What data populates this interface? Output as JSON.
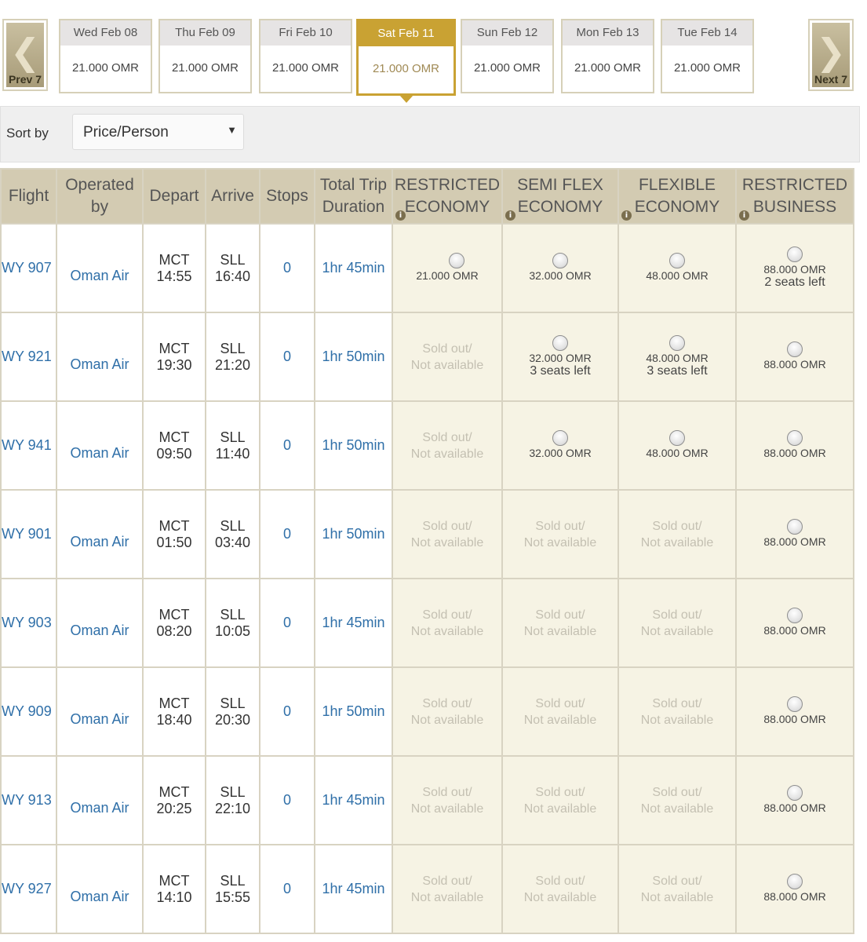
{
  "date_nav": {
    "prev_label": "Prev 7",
    "next_label": "Next 7",
    "days": [
      {
        "date": "Wed Feb 08",
        "price": "21.000 OMR",
        "active": false
      },
      {
        "date": "Thu Feb 09",
        "price": "21.000 OMR",
        "active": false
      },
      {
        "date": "Fri Feb 10",
        "price": "21.000 OMR",
        "active": false
      },
      {
        "date": "Sat Feb 11",
        "price": "21.000 OMR",
        "active": true
      },
      {
        "date": "Sun Feb 12",
        "price": "21.000 OMR",
        "active": false
      },
      {
        "date": "Mon Feb 13",
        "price": "21.000 OMR",
        "active": false
      },
      {
        "date": "Tue Feb 14",
        "price": "21.000 OMR",
        "active": false
      }
    ]
  },
  "sort": {
    "label": "Sort by",
    "selected": "Price/Person"
  },
  "table": {
    "headers": {
      "flight": "Flight",
      "operated_by": [
        "Operated",
        "by"
      ],
      "depart": "Depart",
      "arrive": "Arrive",
      "stops": "Stops",
      "duration": [
        "Total Trip",
        "Duration"
      ],
      "fares": [
        [
          "RESTRICTED",
          "ECONOMY"
        ],
        [
          "SEMI FLEX",
          "ECONOMY"
        ],
        [
          "FLEXIBLE",
          "ECONOMY"
        ],
        [
          "RESTRICTED",
          "BUSINESS"
        ]
      ]
    },
    "sold_out_text": [
      "Sold out/",
      "Not available"
    ],
    "rows": [
      {
        "flight": "WY 907",
        "operator": "Oman Air",
        "dep_code": "MCT",
        "dep_time": "14:55",
        "arr_code": "SLL",
        "arr_time": "16:40",
        "stops": "0",
        "duration": "1hr 45min",
        "fares": [
          {
            "price": "21.000 OMR",
            "seats": ""
          },
          {
            "price": "32.000 OMR",
            "seats": ""
          },
          {
            "price": "48.000 OMR",
            "seats": ""
          },
          {
            "price": "88.000 OMR",
            "seats": "2 seats left"
          }
        ]
      },
      {
        "flight": "WY 921",
        "operator": "Oman Air",
        "dep_code": "MCT",
        "dep_time": "19:30",
        "arr_code": "SLL",
        "arr_time": "21:20",
        "stops": "0",
        "duration": "1hr 50min",
        "fares": [
          null,
          {
            "price": "32.000 OMR",
            "seats": "3 seats left"
          },
          {
            "price": "48.000 OMR",
            "seats": "3 seats left"
          },
          {
            "price": "88.000 OMR",
            "seats": ""
          }
        ]
      },
      {
        "flight": "WY 941",
        "operator": "Oman Air",
        "dep_code": "MCT",
        "dep_time": "09:50",
        "arr_code": "SLL",
        "arr_time": "11:40",
        "stops": "0",
        "duration": "1hr 50min",
        "fares": [
          null,
          {
            "price": "32.000 OMR",
            "seats": ""
          },
          {
            "price": "48.000 OMR",
            "seats": ""
          },
          {
            "price": "88.000 OMR",
            "seats": ""
          }
        ]
      },
      {
        "flight": "WY 901",
        "operator": "Oman Air",
        "dep_code": "MCT",
        "dep_time": "01:50",
        "arr_code": "SLL",
        "arr_time": "03:40",
        "stops": "0",
        "duration": "1hr 50min",
        "fares": [
          null,
          null,
          null,
          {
            "price": "88.000 OMR",
            "seats": ""
          }
        ]
      },
      {
        "flight": "WY 903",
        "operator": "Oman Air",
        "dep_code": "MCT",
        "dep_time": "08:20",
        "arr_code": "SLL",
        "arr_time": "10:05",
        "stops": "0",
        "duration": "1hr 45min",
        "fares": [
          null,
          null,
          null,
          {
            "price": "88.000 OMR",
            "seats": ""
          }
        ]
      },
      {
        "flight": "WY 909",
        "operator": "Oman Air",
        "dep_code": "MCT",
        "dep_time": "18:40",
        "arr_code": "SLL",
        "arr_time": "20:30",
        "stops": "0",
        "duration": "1hr 50min",
        "fares": [
          null,
          null,
          null,
          {
            "price": "88.000 OMR",
            "seats": ""
          }
        ]
      },
      {
        "flight": "WY 913",
        "operator": "Oman Air",
        "dep_code": "MCT",
        "dep_time": "20:25",
        "arr_code": "SLL",
        "arr_time": "22:10",
        "stops": "0",
        "duration": "1hr 45min",
        "fares": [
          null,
          null,
          null,
          {
            "price": "88.000 OMR",
            "seats": ""
          }
        ]
      },
      {
        "flight": "WY 927",
        "operator": "Oman Air",
        "dep_code": "MCT",
        "dep_time": "14:10",
        "arr_code": "SLL",
        "arr_time": "15:55",
        "stops": "0",
        "duration": "1hr 45min",
        "fares": [
          null,
          null,
          null,
          {
            "price": "88.000 OMR",
            "seats": ""
          }
        ]
      }
    ]
  },
  "colors": {
    "accent": "#c9a233",
    "link": "#2f6fa8",
    "header_bg": "#d3cbb2",
    "fare_bg": "#f6f3e4"
  }
}
